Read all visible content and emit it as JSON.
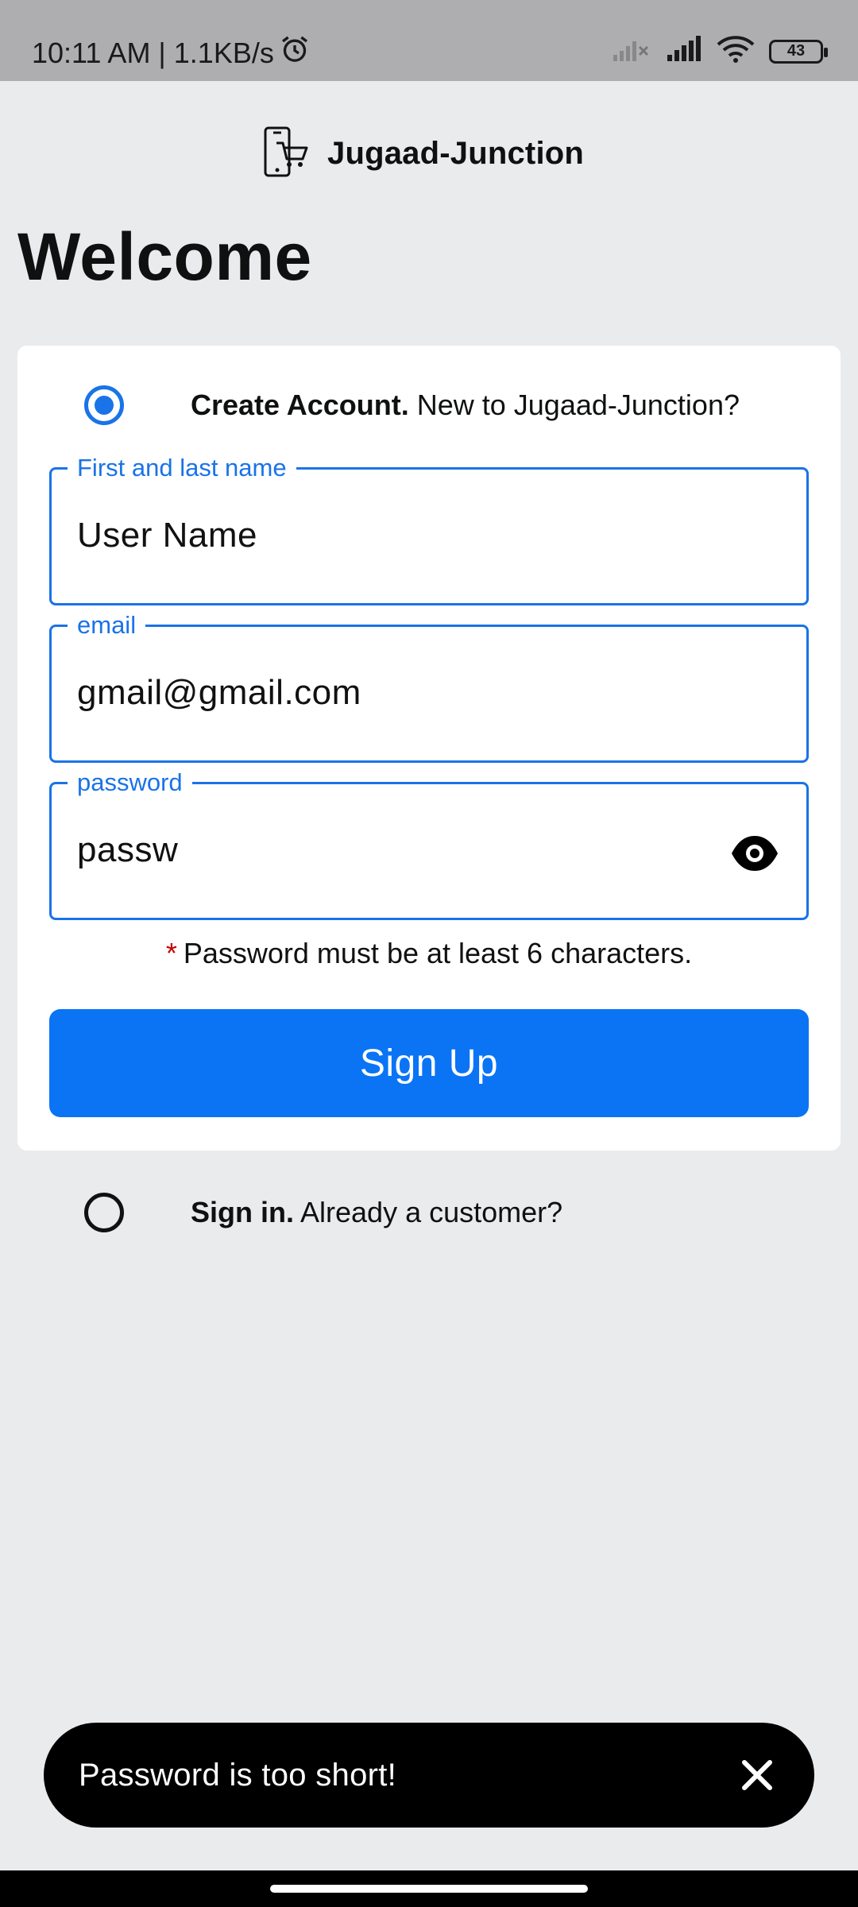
{
  "status_bar": {
    "time_speed": "10:11 AM | 1.1KB/s",
    "battery": "43",
    "icons": [
      "alarm-icon",
      "signal-off-icon",
      "signal-icon",
      "wifi-icon",
      "battery-icon"
    ]
  },
  "brand": {
    "name": "Jugaad-Junction",
    "icon": "phone-cart-icon"
  },
  "page": {
    "title": "Welcome"
  },
  "create_account": {
    "label_bold": "Create Account.",
    "label_rest": " New to Jugaad-Junction?",
    "selected": true
  },
  "fields": {
    "name": {
      "label": "First and last name",
      "value": "User Name"
    },
    "email": {
      "label": "email",
      "value": "gmail@gmail.com"
    },
    "password": {
      "label": "password",
      "value": "passw",
      "toggle_icon": "eye-icon"
    }
  },
  "hint": {
    "star": "*",
    "text": "Password must be at least 6 characters."
  },
  "signup": {
    "label": "Sign Up"
  },
  "sign_in": {
    "label_bold": "Sign in.",
    "label_rest": " Already a customer?",
    "selected": false
  },
  "snackbar": {
    "message": "Password is too short!",
    "close_icon": "close-icon"
  },
  "colors": {
    "accent": "#1a73e8",
    "button": "#0a74f5",
    "background": "#eaebed",
    "error": "#c40000"
  }
}
